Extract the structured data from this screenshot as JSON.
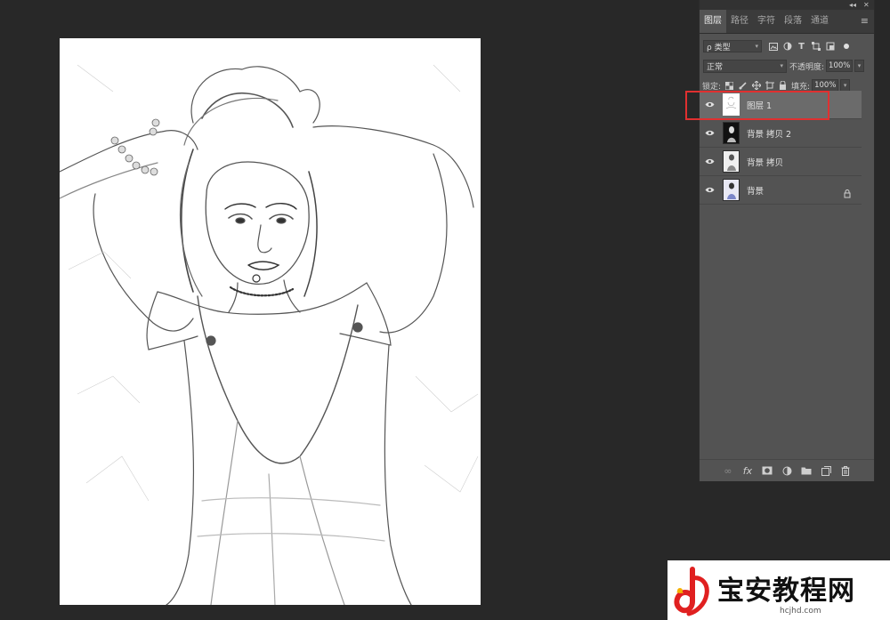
{
  "panel": {
    "topbar": {
      "collapse": "◂◂",
      "close": "✕"
    },
    "tabs": [
      {
        "label": "图层",
        "active": true
      },
      {
        "label": "路径",
        "active": false
      },
      {
        "label": "字符",
        "active": false
      },
      {
        "label": "段落",
        "active": false
      },
      {
        "label": "通道",
        "active": false
      }
    ],
    "filter": {
      "label": "ρ 类型"
    },
    "blend_mode": "正常",
    "opacity_label": "不透明度:",
    "opacity_value": "100%",
    "lock_label": "锁定:",
    "fill_label": "填充:",
    "fill_value": "100%",
    "layers": [
      {
        "name": "图层 1",
        "selected": true,
        "locked": false
      },
      {
        "name": "背景 拷贝 2",
        "selected": false,
        "locked": false
      },
      {
        "name": "背景 拷贝",
        "selected": false,
        "locked": false
      },
      {
        "name": "背景",
        "selected": false,
        "locked": true
      }
    ],
    "bottom_icons": [
      "link-icon",
      "fx-icon",
      "mask-icon",
      "adjustment-icon",
      "folder-icon",
      "new-layer-icon",
      "trash-icon"
    ]
  },
  "watermark": {
    "title": "宝安教程网",
    "url": "hcjhd.com"
  },
  "colors": {
    "highlight": "#e03030",
    "workspace": "#282828",
    "panel": "#535353"
  }
}
